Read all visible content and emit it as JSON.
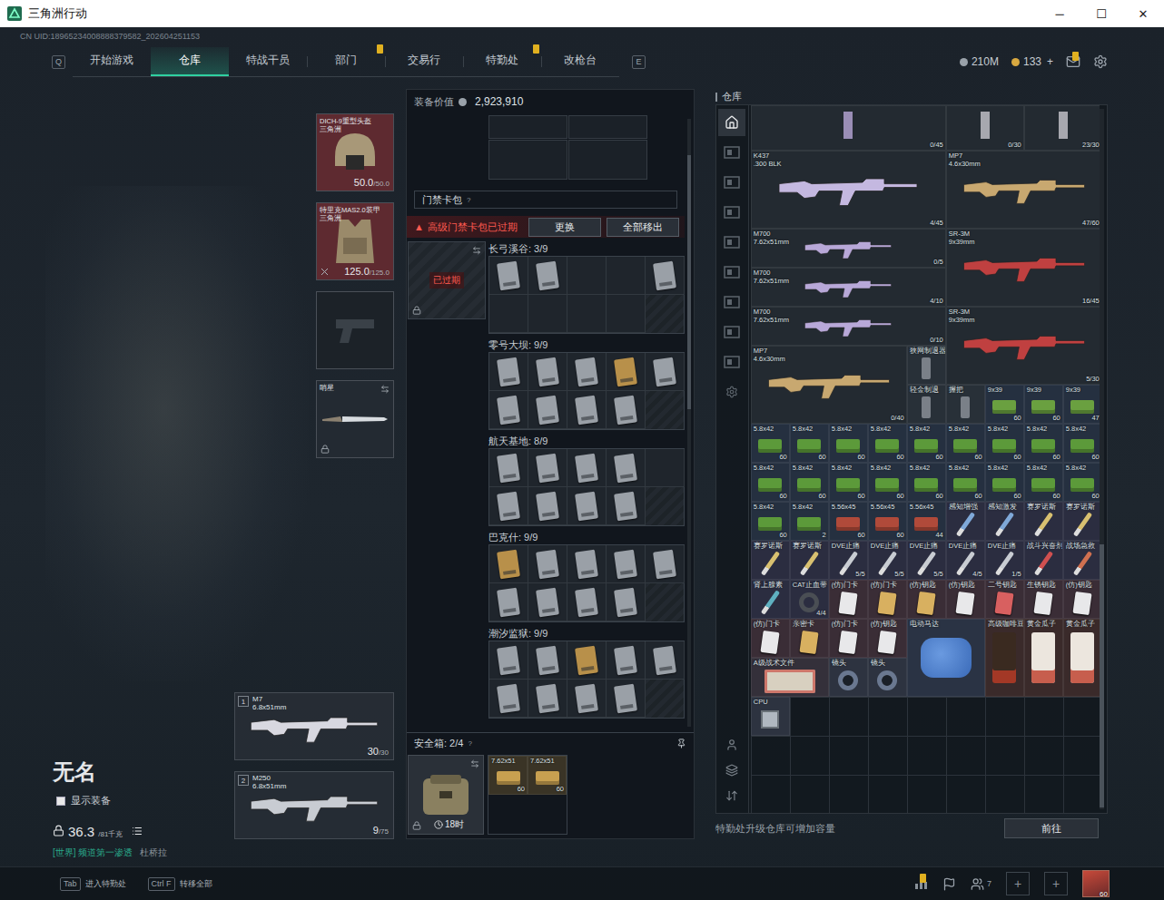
{
  "window": {
    "title": "三角洲行动",
    "controls": [
      "─",
      "☐",
      "✕"
    ]
  },
  "uid": "CN UID:18965234008888379582_202604251153",
  "nav": {
    "prev_key": "Q",
    "next_key": "E",
    "tabs": [
      {
        "label": "开始游戏",
        "selected": false,
        "badge": false
      },
      {
        "label": "仓库",
        "selected": true,
        "badge": false
      },
      {
        "label": "特战干员",
        "selected": false,
        "badge": false
      },
      {
        "label": "部门",
        "selected": false,
        "badge": true
      },
      {
        "label": "交易行",
        "selected": false,
        "badge": false
      },
      {
        "label": "特勤处",
        "selected": false,
        "badge": true
      },
      {
        "label": "改枪台",
        "selected": false,
        "badge": false
      }
    ]
  },
  "currency": {
    "havoc": "210M",
    "coupons": "133",
    "add": "+"
  },
  "mail": {
    "badge": true
  },
  "operator": {
    "name": "无名",
    "show_equipment": {
      "label": "显示装备",
      "checked": false
    },
    "weight": "36.3",
    "weight_max": "/81千克",
    "status_channel": "[世界]",
    "status_text": "频道第一渗透",
    "status_name": "杜桥拉"
  },
  "equipment": [
    {
      "kind": "helmet",
      "name": "DICH-9重型头盔",
      "sub": "三角洲",
      "value": "50.0",
      "max": "/50.0",
      "color": "#5e2a30"
    },
    {
      "kind": "armor",
      "name": "特里克MAS2.0装甲",
      "sub": "三角洲",
      "value": "125.0",
      "max": "/125.0",
      "color": "#5e2a30"
    },
    {
      "kind": "pistol",
      "color": "#1c2228"
    },
    {
      "kind": "melee",
      "name": "哨星",
      "color": "#232a32"
    }
  ],
  "weapons": [
    {
      "index": "1",
      "name": "M7",
      "caliber": "6.8x51mm",
      "ammo": "30",
      "capacity": "/30",
      "color": "#d8d8e0"
    },
    {
      "index": "2",
      "name": "M250",
      "caliber": "6.8x51mm",
      "ammo": "9",
      "capacity": "/75",
      "color": "#c8ccd2"
    }
  ],
  "loadout": {
    "value_label": "装备价值",
    "value": "2,923,910"
  },
  "keycard_case": {
    "title": "门禁卡包",
    "help": "?",
    "warning_icon": "▲",
    "warning": "高级门禁卡包已过期",
    "buttons": [
      "更换",
      "全部移出"
    ],
    "case_status": "已过期",
    "maps": [
      {
        "label": "长弓溪谷: 3/9",
        "slots": [
          {
            "filled": true,
            "color": "#9aa0a7"
          },
          {
            "filled": true,
            "color": "#9aa0a7"
          },
          {
            "filled": false
          },
          {
            "filled": false
          },
          {
            "filled": true,
            "color": "#9aa0a7"
          },
          {
            "filled": false
          },
          {
            "filled": false
          },
          {
            "filled": false
          },
          {
            "filled": false
          }
        ]
      },
      {
        "label": "零号大坝: 9/9",
        "slots": [
          {
            "filled": true,
            "color": "#9aa0a7"
          },
          {
            "filled": true,
            "color": "#9aa0a7"
          },
          {
            "filled": true,
            "color": "#9aa0a7"
          },
          {
            "filled": true,
            "color": "#b8904a"
          },
          {
            "filled": true,
            "color": "#9aa0a7"
          },
          {
            "filled": true,
            "color": "#9aa0a7"
          },
          {
            "filled": true,
            "color": "#9aa0a7"
          },
          {
            "filled": true,
            "color": "#9aa0a7"
          },
          {
            "filled": true,
            "color": "#9aa0a7"
          }
        ]
      },
      {
        "label": "航天基地: 8/9",
        "slots": [
          {
            "filled": true,
            "color": "#9aa0a7"
          },
          {
            "filled": true,
            "color": "#9aa0a7"
          },
          {
            "filled": true,
            "color": "#9aa0a7"
          },
          {
            "filled": true,
            "color": "#9aa0a7"
          },
          {
            "filled": false
          },
          {
            "filled": true,
            "color": "#9aa0a7"
          },
          {
            "filled": true,
            "color": "#9aa0a7"
          },
          {
            "filled": true,
            "color": "#9aa0a7"
          },
          {
            "filled": true,
            "color": "#9aa0a7"
          }
        ]
      },
      {
        "label": "巴克什: 9/9",
        "slots": [
          {
            "filled": true,
            "color": "#b8904a"
          },
          {
            "filled": true,
            "color": "#9aa0a7"
          },
          {
            "filled": true,
            "color": "#9aa0a7"
          },
          {
            "filled": true,
            "color": "#9aa0a7"
          },
          {
            "filled": true,
            "color": "#9aa0a7"
          },
          {
            "filled": true,
            "color": "#9aa0a7"
          },
          {
            "filled": true,
            "color": "#9aa0a7"
          },
          {
            "filled": true,
            "color": "#9aa0a7"
          },
          {
            "filled": true,
            "color": "#9aa0a7"
          }
        ]
      },
      {
        "label": "潮汐监狱: 9/9",
        "slots": [
          {
            "filled": true,
            "color": "#9aa0a7"
          },
          {
            "filled": true,
            "color": "#9aa0a7"
          },
          {
            "filled": true,
            "color": "#b8904a"
          },
          {
            "filled": true,
            "color": "#9aa0a7"
          },
          {
            "filled": true,
            "color": "#9aa0a7"
          },
          {
            "filled": true,
            "color": "#9aa0a7"
          },
          {
            "filled": true,
            "color": "#9aa0a7"
          },
          {
            "filled": true,
            "color": "#9aa0a7"
          },
          {
            "filled": true,
            "color": "#9aa0a7"
          }
        ]
      }
    ]
  },
  "safe_box": {
    "title": "安全箱: 2/4",
    "help": "?",
    "timer": "18时",
    "items": [
      {
        "name": "7.62x51",
        "count": "60",
        "color": "#c8a050"
      },
      {
        "name": "7.62x51",
        "count": "60",
        "color": "#c8a050"
      }
    ]
  },
  "warehouse": {
    "title": "仓库",
    "side_tabs": [
      {
        "kind": "home",
        "selected": true
      },
      {
        "kind": "storage",
        "selected": false
      },
      {
        "kind": "storage",
        "selected": false
      },
      {
        "kind": "storage",
        "selected": false
      },
      {
        "kind": "storage",
        "selected": false
      },
      {
        "kind": "storage",
        "selected": false
      },
      {
        "kind": "storage",
        "selected": false
      },
      {
        "kind": "storage",
        "selected": false
      },
      {
        "kind": "storage",
        "selected": false
      },
      {
        "kind": "settings",
        "selected": false
      }
    ],
    "tools": [
      {
        "kind": "operator"
      },
      {
        "kind": "layers"
      },
      {
        "kind": "sort"
      }
    ],
    "footer": "特勤处升级仓库可增加容量",
    "button": "前往",
    "items": [
      {
        "kind": "cut-wide",
        "count": "0/45",
        "color": "#b8a8d8"
      },
      {
        "kind": "cut-narrow",
        "count": "0/30",
        "color": "#c8c8d0"
      },
      {
        "kind": "cut-narrow",
        "count": "23/30",
        "color": "#c8c8d0"
      },
      {
        "kind": "rifle",
        "name": "K437",
        "sub": ".300 BLK",
        "count": "4/45",
        "color": "#c4b8e0"
      },
      {
        "kind": "smg",
        "name": "MP7",
        "sub": "4.6x30mm",
        "count": "47/60",
        "color": "#c8a870"
      },
      {
        "kind": "sniper",
        "name": "M700",
        "sub": "7.62x51mm",
        "count": "0/5",
        "color": "#b8a8d8"
      },
      {
        "kind": "marksman",
        "name": "SR-3M",
        "sub": "9x39mm",
        "count": "16/45",
        "color": "#c04040"
      },
      {
        "kind": "sniper",
        "name": "M700",
        "sub": "7.62x51mm",
        "count": "4/10",
        "color": "#b8a8d8"
      },
      {
        "kind": "sniper",
        "name": "M700",
        "sub": "7.62x51mm",
        "count": "0/10",
        "color": "#b8a8d8"
      },
      {
        "kind": "marksman",
        "name": "SR-3M",
        "sub": "9x39mm",
        "count": "5/30",
        "color": "#c04040"
      },
      {
        "kind": "smg",
        "name": "MP7",
        "sub": "4.6x30mm",
        "count": "0/40",
        "color": "#c8a870"
      },
      {
        "kind": "attachment",
        "name": "狭网制退器",
        "color": "#7a8088"
      },
      {
        "kind": "attachment",
        "name": "轻金制退",
        "color": "#7a8088"
      },
      {
        "kind": "attachment",
        "name": "握把",
        "color": "#7a8088"
      },
      {
        "kind": "ammo",
        "name": "9x39",
        "count": "60",
        "color": "#6aa040"
      },
      {
        "kind": "ammo",
        "name": "9x39",
        "count": "60",
        "color": "#6aa040"
      },
      {
        "kind": "ammo",
        "name": "9x39",
        "count": "47",
        "color": "#6aa040"
      },
      {
        "kind": "ammo",
        "name": "5.8x42",
        "count": "60",
        "color": "#5c9a3a"
      },
      {
        "kind": "ammo",
        "name": "5.8x42",
        "count": "60",
        "color": "#5c9a3a"
      },
      {
        "kind": "ammo",
        "name": "5.8x42",
        "count": "60",
        "color": "#5c9a3a"
      },
      {
        "kind": "ammo",
        "name": "5.8x42",
        "count": "60",
        "color": "#5c9a3a"
      },
      {
        "kind": "ammo",
        "name": "5.8x42",
        "count": "60",
        "color": "#5c9a3a"
      },
      {
        "kind": "ammo",
        "name": "5.8x42",
        "count": "60",
        "color": "#5c9a3a"
      },
      {
        "kind": "ammo",
        "name": "5.8x42",
        "count": "60",
        "color": "#5c9a3a"
      },
      {
        "kind": "ammo",
        "name": "5.8x42",
        "count": "60",
        "color": "#5c9a3a"
      },
      {
        "kind": "ammo",
        "name": "5.8x42",
        "count": "60",
        "color": "#5c9a3a"
      },
      {
        "kind": "ammo",
        "name": "5.8x42",
        "count": "60",
        "color": "#5c9a3a"
      },
      {
        "kind": "ammo",
        "name": "5.8x42",
        "count": "60",
        "color": "#5c9a3a"
      },
      {
        "kind": "ammo",
        "name": "5.8x42",
        "count": "60",
        "color": "#5c9a3a"
      },
      {
        "kind": "ammo",
        "name": "5.8x42",
        "count": "60",
        "color": "#5c9a3a"
      },
      {
        "kind": "ammo",
        "name": "5.8x42",
        "count": "60",
        "color": "#5c9a3a"
      },
      {
        "kind": "ammo",
        "name": "5.8x42",
        "count": "60",
        "color": "#5c9a3a"
      },
      {
        "kind": "ammo",
        "name": "5.8x42",
        "count": "60",
        "color": "#5c9a3a"
      },
      {
        "kind": "ammo",
        "name": "5.8x42",
        "count": "60",
        "color": "#5c9a3a"
      },
      {
        "kind": "ammo",
        "name": "5.8x42",
        "count": "60",
        "color": "#5c9a3a"
      },
      {
        "kind": "ammo",
        "name": "5.8x42",
        "count": "60",
        "color": "#5c9a3a"
      },
      {
        "kind": "ammo",
        "name": "5.8x42",
        "count": "2",
        "color": "#5c9a3a"
      },
      {
        "kind": "ammo",
        "name": "5.56x45",
        "count": "60",
        "color": "#b04a3a"
      },
      {
        "kind": "ammo",
        "name": "5.56x45",
        "count": "60",
        "color": "#b04a3a"
      },
      {
        "kind": "ammo",
        "name": "5.56x45",
        "count": "44",
        "color": "#b04a3a"
      },
      {
        "kind": "injector",
        "name": "感知增强",
        "color": "#7fa8d8"
      },
      {
        "kind": "injector",
        "name": "感知激发",
        "color": "#7fa8d8"
      },
      {
        "kind": "injector",
        "name": "赛罗诺斯",
        "color": "#d8c070"
      },
      {
        "kind": "injector",
        "name": "赛罗诺斯",
        "color": "#d8c070"
      },
      {
        "kind": "injector",
        "name": "赛罗诺斯",
        "color": "#d8c070"
      },
      {
        "kind": "injector",
        "name": "赛罗诺斯",
        "color": "#d8c070"
      },
      {
        "kind": "injector",
        "name": "DVE止痛",
        "count": "5/5",
        "color": "#c8ccd2"
      },
      {
        "kind": "injector",
        "name": "DVE止痛",
        "count": "5/5",
        "color": "#c8ccd2"
      },
      {
        "kind": "injector",
        "name": "DVE止痛",
        "count": "5/5",
        "color": "#c8ccd2"
      },
      {
        "kind": "injector",
        "name": "DVE止痛",
        "count": "4/5",
        "color": "#c8ccd2"
      },
      {
        "kind": "injector",
        "name": "DVE止痛",
        "count": "1/5",
        "color": "#c8ccd2"
      },
      {
        "kind": "injector",
        "name": "战斗兴奋剂",
        "color": "#d05050"
      },
      {
        "kind": "injector",
        "name": "战场急救",
        "color": "#d07050"
      },
      {
        "kind": "injector",
        "name": "肾上腺素",
        "color": "#5fb0c0"
      },
      {
        "kind": "tourniquet",
        "name": "CAT止血带",
        "count": "4/4",
        "color": "#4a4e54"
      },
      {
        "kind": "card",
        "name": "(仿)门卡",
        "color": "#e8e8ea"
      },
      {
        "kind": "card",
        "name": "(仿)门卡",
        "color": "#d8b060"
      },
      {
        "kind": "card",
        "name": "(仿)钥匙",
        "color": "#d8b060"
      },
      {
        "kind": "card",
        "name": "(仿)钥匙",
        "color": "#e8e8ea"
      },
      {
        "kind": "card",
        "name": "二号钥匙",
        "color": "#d86060"
      },
      {
        "kind": "card",
        "name": "生锈钥匙",
        "color": "#e8e8ea"
      },
      {
        "kind": "card",
        "name": "(仿)钥匙",
        "color": "#e8e8ea"
      },
      {
        "kind": "card",
        "name": "(仿)门卡",
        "color": "#e8e8ea"
      },
      {
        "kind": "card",
        "name": "亲密卡",
        "color": "#d8b060"
      },
      {
        "kind": "card",
        "name": "(仿)门卡",
        "color": "#e8e8ea"
      },
      {
        "kind": "card",
        "name": "(仿)钥匙",
        "color": "#e8e8ea"
      },
      {
        "kind": "motor",
        "name": "电动马达",
        "color": "#3a6ab8"
      },
      {
        "kind": "coffee",
        "name": "高级咖啡豆",
        "color": "#3a2a20"
      },
      {
        "kind": "snack",
        "name": "黄金瓜子",
        "color": "#ece6de"
      },
      {
        "kind": "snack",
        "name": "黄金瓜子",
        "color": "#ece6de"
      },
      {
        "kind": "document",
        "name": "A级战术文件",
        "color": "#d8d0c0"
      },
      {
        "kind": "lens",
        "name": "镜头",
        "color": "#6a7890"
      },
      {
        "kind": "lens",
        "name": "镜头",
        "color": "#6a7890"
      },
      {
        "kind": "cpu",
        "name": "CPU",
        "color": "#b0b8c0"
      }
    ]
  },
  "bottom_bar": {
    "hints": [
      {
        "key": "Tab",
        "label": "进入特勤处"
      },
      {
        "key": "Ctrl F",
        "label": "转移全部"
      }
    ],
    "chart_badge": true,
    "friends": "7",
    "add_buttons": [
      "+",
      "+"
    ],
    "level": "60"
  }
}
